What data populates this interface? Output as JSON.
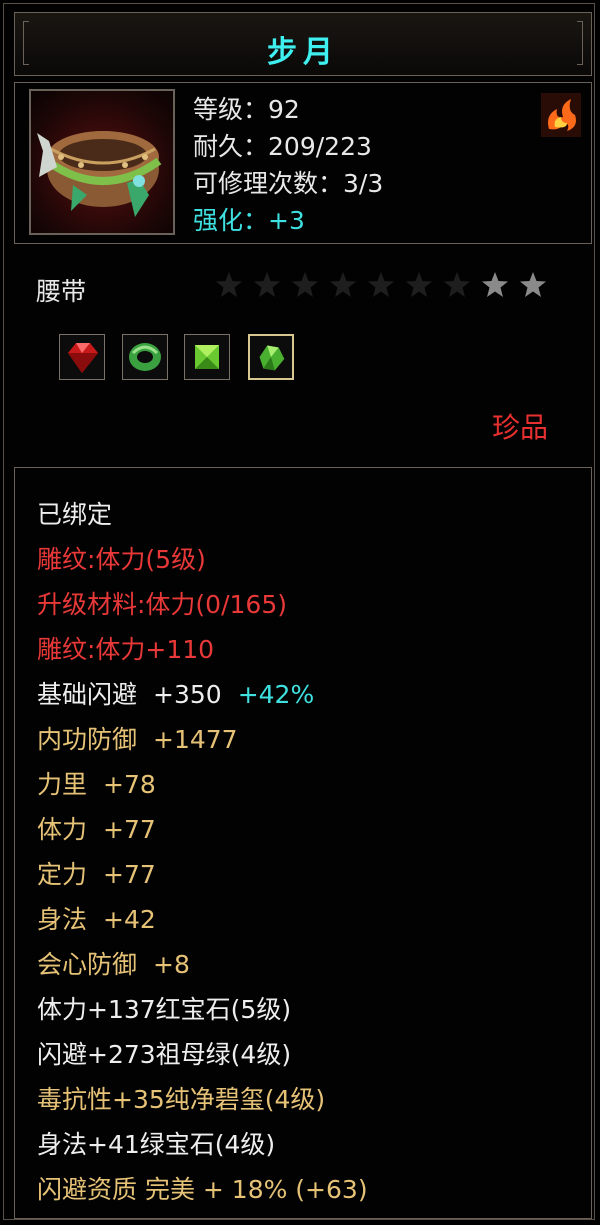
{
  "item": {
    "name": "步月",
    "type": "腰带",
    "rarity": "珍品",
    "stats": [
      {
        "label": "等级",
        "value": "92"
      },
      {
        "label": "耐久",
        "value": "209/223"
      },
      {
        "label": "可修理次数",
        "value": "3/3"
      },
      {
        "label": "强化",
        "value": "+3"
      }
    ],
    "stars": {
      "total": 9,
      "filled": 2
    },
    "gems": [
      "red-gem-icon",
      "green-ring-icon",
      "green-gem-icon",
      "green-jade-icon"
    ],
    "selected_gem": 3
  },
  "attributes": [
    {
      "text": "已绑定",
      "value": "",
      "extra": "",
      "color": "white"
    },
    {
      "text": "雕纹:体力(5级)",
      "value": "",
      "extra": "",
      "color": "red"
    },
    {
      "text": "升级材料:体力(0/165)",
      "value": "",
      "extra": "",
      "color": "red"
    },
    {
      "text": "雕纹:体力+110",
      "value": "",
      "extra": "",
      "color": "red"
    },
    {
      "text": "基础闪避",
      "value": "+350",
      "extra": "+42%",
      "color": "white"
    },
    {
      "text": "内功防御",
      "value": "+1477",
      "extra": "",
      "color": "gold"
    },
    {
      "text": "力里",
      "value": "+78",
      "extra": "",
      "color": "gold"
    },
    {
      "text": "体力",
      "value": "+77",
      "extra": "",
      "color": "gold"
    },
    {
      "text": "定力",
      "value": "+77",
      "extra": "",
      "color": "gold"
    },
    {
      "text": "身法",
      "value": "+42",
      "extra": "",
      "color": "gold"
    },
    {
      "text": "会心防御",
      "value": "+8",
      "extra": "",
      "color": "gold"
    },
    {
      "text": "体力+137红宝石(5级)",
      "value": "",
      "extra": "",
      "color": "white"
    },
    {
      "text": "闪避+273祖母绿(4级)",
      "value": "",
      "extra": "",
      "color": "white"
    },
    {
      "text": "毒抗性+35纯净碧玺(4级)",
      "value": "",
      "extra": "",
      "color": "white"
    },
    {
      "text": "身法+41绿宝石(4级)",
      "value": "",
      "extra": "",
      "color": "white"
    },
    {
      "text": "闪避资质 完美 + 18% (+63)",
      "value": "",
      "extra": "",
      "color": "gold"
    }
  ],
  "colors": {
    "title": "#3ff0f0",
    "red": "#e83838",
    "gold": "#e6c277",
    "white": "#eeeeee",
    "cyan": "#3fe0e0",
    "border": "#6a6258"
  }
}
